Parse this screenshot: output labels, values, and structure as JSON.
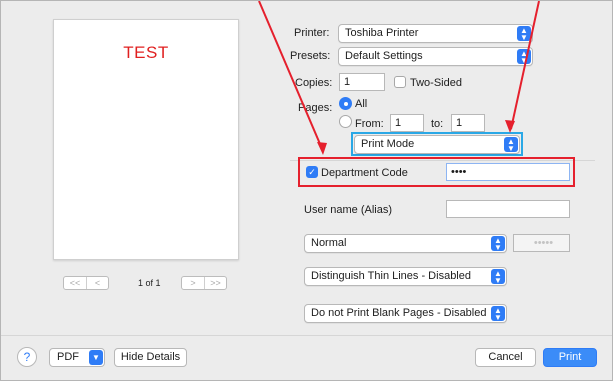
{
  "preview": {
    "sample_text": "TEST",
    "page_indicator": "1 of 1",
    "first_label": "<<",
    "prev_label": "<",
    "next_label": ">",
    "last_label": ">>"
  },
  "printer": {
    "label": "Printer:",
    "value": "Toshiba Printer"
  },
  "presets": {
    "label": "Presets:",
    "value": "Default Settings"
  },
  "copies": {
    "label": "Copies:",
    "value": "1",
    "two_sided_label": "Two-Sided"
  },
  "pages": {
    "label": "Pages:",
    "all_label": "All",
    "from_label": "From:",
    "from_value": "1",
    "to_label": "to:",
    "to_value": "1"
  },
  "panel_select": {
    "value": "Print Mode"
  },
  "department_code": {
    "label": "Department Code",
    "value": "••••",
    "checked": true
  },
  "user_name": {
    "label": "User name (Alias)",
    "value": ""
  },
  "mode_select": {
    "value": "Normal",
    "password_placeholder": "•••••"
  },
  "thin_lines_select": {
    "value": "Distinguish Thin Lines - Disabled"
  },
  "blank_pages_select": {
    "value": "Do not Print Blank Pages - Disabled"
  },
  "footer": {
    "help_label": "?",
    "pdf_label": "PDF",
    "hide_details_label": "Hide Details",
    "cancel_label": "Cancel",
    "print_label": "Print"
  },
  "icons": {
    "chevron": "updown-chevron-icon",
    "checkmark": "checkmark-icon",
    "help": "help-icon"
  },
  "colors": {
    "accent": "#2f7cf6",
    "sample_text": "#e01f1f",
    "highlight_red": "#e5202d",
    "highlight_blue": "#2aa8e6"
  }
}
